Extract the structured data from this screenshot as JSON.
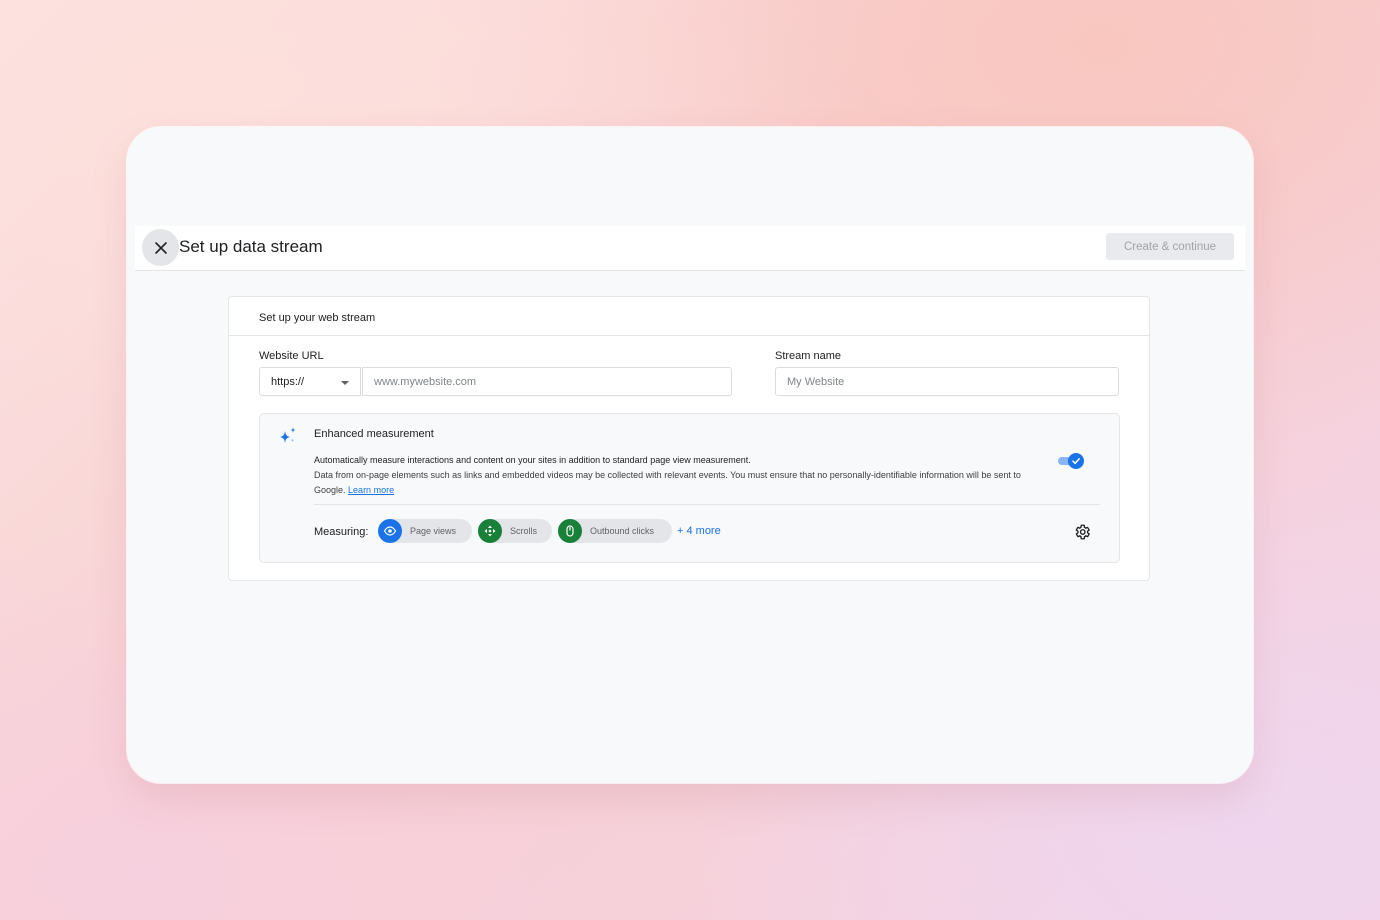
{
  "header": {
    "title": "Set up data stream",
    "create_button": "Create & continue"
  },
  "card": {
    "title": "Set up your web stream",
    "website_url": {
      "label": "Website URL",
      "scheme": "https://",
      "placeholder": "www.mywebsite.com"
    },
    "stream_name": {
      "label": "Stream name",
      "placeholder": "My Website"
    }
  },
  "enhanced_measurement": {
    "title": "Enhanced measurement",
    "description_line1": "Automatically measure interactions and content on your sites in addition to standard page view measurement.",
    "description_line2": "Data from on-page elements such as links and embedded videos may be collected with relevant events. You must ensure that no personally-identifiable information will be sent to Google.",
    "learn_more": "Learn more",
    "toggle_on": true,
    "measuring_label": "Measuring:",
    "chips": [
      {
        "label": "Page views",
        "icon": "eye-icon",
        "color": "#1a73e8"
      },
      {
        "label": "Scrolls",
        "icon": "scroll-target-icon",
        "color": "#188038"
      },
      {
        "label": "Outbound clicks",
        "icon": "mouse-icon",
        "color": "#188038"
      }
    ],
    "more_link": "+ 4 more"
  },
  "colors": {
    "accent": "#1a73e8",
    "chip_green": "#188038",
    "surface": "#f8f9fa"
  }
}
